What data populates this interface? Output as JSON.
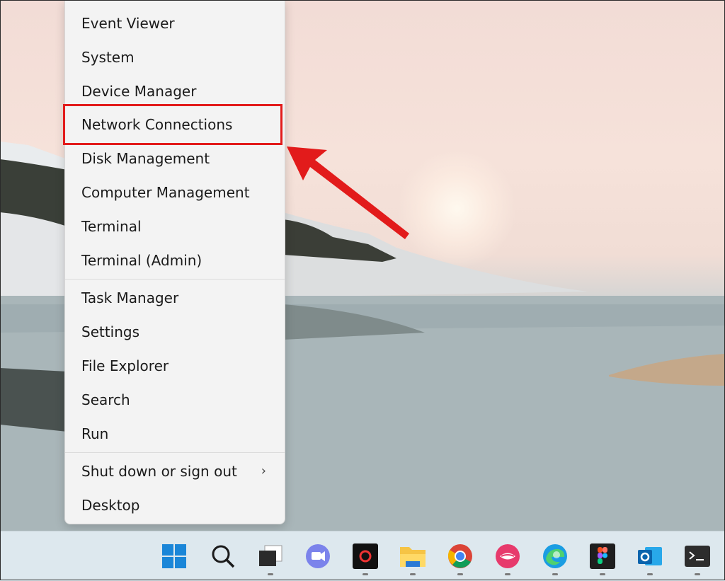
{
  "context_menu": {
    "items": [
      {
        "label": "Event Viewer"
      },
      {
        "label": "System"
      },
      {
        "label": "Device Manager"
      },
      {
        "label": "Network Connections"
      },
      {
        "label": "Disk Management"
      },
      {
        "label": "Computer Management"
      },
      {
        "label": "Terminal"
      },
      {
        "label": "Terminal (Admin)"
      },
      {
        "label": "Task Manager"
      },
      {
        "label": "Settings"
      },
      {
        "label": "File Explorer"
      },
      {
        "label": "Search"
      },
      {
        "label": "Run"
      },
      {
        "label": "Shut down or sign out",
        "submenu_glyph": "›"
      },
      {
        "label": "Desktop"
      }
    ],
    "highlighted_item": "Network Connections",
    "highlight_color": "#e21b1b"
  },
  "taskbar": {
    "icons": [
      "windows-start-icon",
      "search-icon",
      "task-view-icon",
      "teams-chat-icon",
      "app-black-icon",
      "file-explorer-icon",
      "chrome-icon",
      "app-lips-icon",
      "edge-icon",
      "figma-icon",
      "outlook-icon",
      "terminal-icon"
    ]
  }
}
